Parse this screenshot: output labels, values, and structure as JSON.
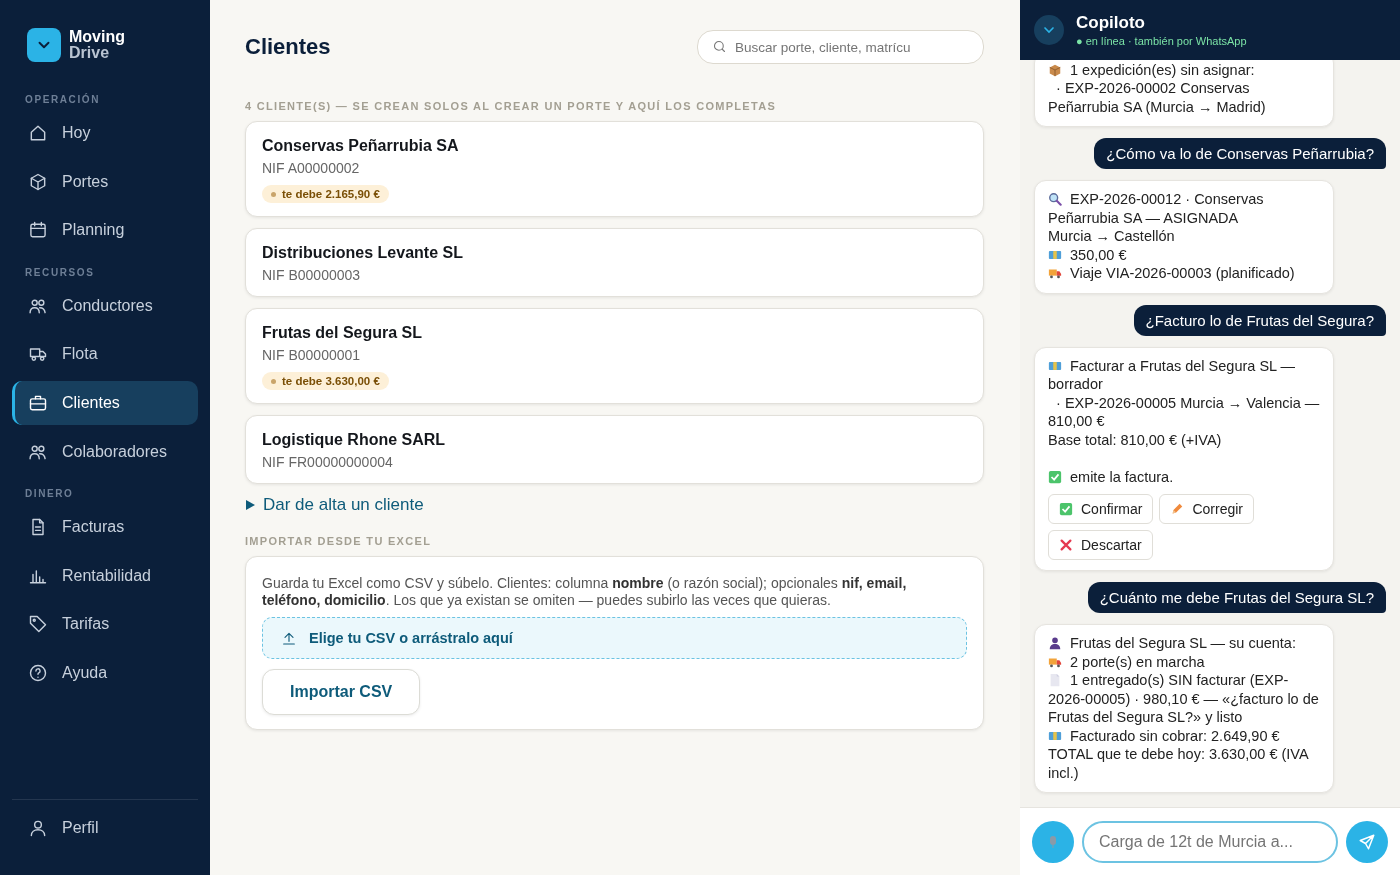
{
  "brand": {
    "line1": "Moving",
    "line2": "Drive"
  },
  "sidebar": {
    "sections": [
      {
        "title": "OPERACIÓN",
        "items": [
          {
            "label": "Hoy",
            "kind": "home",
            "selected": false
          },
          {
            "label": "Portes",
            "kind": "cube",
            "selected": false
          },
          {
            "label": "Planning",
            "kind": "calendar",
            "selected": false
          }
        ]
      },
      {
        "title": "RECURSOS",
        "items": [
          {
            "label": "Conductores",
            "kind": "people",
            "selected": false
          },
          {
            "label": "Flota",
            "kind": "truck",
            "selected": false
          },
          {
            "label": "Clientes",
            "kind": "briefcase",
            "selected": true
          },
          {
            "label": "Colaboradores",
            "kind": "people",
            "selected": false
          }
        ]
      },
      {
        "title": "DINERO",
        "items": [
          {
            "label": "Facturas",
            "kind": "document",
            "selected": false
          },
          {
            "label": "Rentabilidad",
            "kind": "chart",
            "selected": false
          },
          {
            "label": "Tarifas",
            "kind": "tag",
            "selected": false
          },
          {
            "label": "Ayuda",
            "kind": "help",
            "selected": false
          }
        ]
      }
    ],
    "footer_item": {
      "label": "Perfil",
      "kind": "user"
    }
  },
  "page": {
    "title": "Clientes",
    "search": {
      "placeholder": "Buscar porte, cliente, matrícu"
    },
    "list_caption": "4 CLIENTE(S) — SE CREAN SOLOS AL CREAR UN PORTE Y AQUÍ LOS COMPLETAS",
    "clients": [
      {
        "name": "Conservas Peñarrubia SA",
        "nif": "NIF A00000002",
        "debt": "te debe 2.165,90 €"
      },
      {
        "name": "Distribuciones Levante SL",
        "nif": "NIF B00000003"
      },
      {
        "name": "Frutas del Segura SL",
        "nif": "NIF B00000001",
        "debt": "te debe 3.630,00 €"
      },
      {
        "name": "Logistique Rhone SARL",
        "nif": "NIF FR00000000004"
      }
    ],
    "add_client": {
      "label": "Dar de alta un cliente",
      "expanded": false
    },
    "import_caption": "IMPORTAR DESDE TU EXCEL",
    "import": {
      "text": "Guarda tu Excel como CSV y súbelo. Clientes: columna **nombre** (o razón social); opcionales **nif, email, teléfono, domicilio**. Los que ya existan se omiten — puedes subirlo las veces que quieras.",
      "dropzone": "Elige tu CSV o arrástralo aquí",
      "button": "Importar CSV"
    }
  },
  "copilot": {
    "title": "Copiloto",
    "status": "● en línea · también por WhatsApp",
    "messages": [
      {
        "kind": "bot",
        "lines": [
          {
            "kind": "box",
            "text": "1 expedición(es) sin asignar:"
          },
          {
            "kind": "plain",
            "text": "  · EXP-2026-00002 Conservas Peñarrubia SA (Murcia → Madrid)"
          }
        ]
      },
      {
        "kind": "user",
        "text": "¿Cómo va lo de Conservas Peñarrubia?"
      },
      {
        "kind": "bot",
        "lines": [
          {
            "kind": "search",
            "text": "EXP-2026-00012 · Conservas Peñarrubia SA — ASIGNADA"
          },
          {
            "kind": "plain",
            "text": "Murcia → Castellón"
          },
          {
            "kind": "money",
            "text": "350,00 €"
          },
          {
            "kind": "truck",
            "text": "Viaje VIA-2026-00003 (planificado)"
          }
        ]
      },
      {
        "kind": "user",
        "text": "¿Facturo lo de Frutas del Segura?"
      },
      {
        "kind": "bot",
        "lines": [
          {
            "kind": "money",
            "text": "Facturar a Frutas del Segura SL — borrador"
          },
          {
            "kind": "plain",
            "text": "  · EXP-2026-00005 Murcia → Valencia — 810,00 €"
          },
          {
            "kind": "plain",
            "text": "Base total: 810,00 € (+IVA)"
          },
          {
            "kind": "check",
            "text": "emite la factura.",
            "spaced": true
          }
        ],
        "actions": [
          {
            "kind": "check",
            "label": "Confirmar"
          },
          {
            "kind": "pencil",
            "label": "Corregir"
          },
          {
            "kind": "cross",
            "label": "Descartar"
          }
        ]
      },
      {
        "kind": "user",
        "text": "¿Cuánto me debe Frutas del Segura SL?"
      },
      {
        "kind": "bot",
        "lines": [
          {
            "kind": "person",
            "text": "Frutas del Segura SL — su cuenta:"
          },
          {
            "kind": "truck",
            "text": "2 porte(s) en marcha"
          },
          {
            "kind": "doc",
            "text": "1 entregado(s) SIN facturar (EXP-2026-00005) · 980,10 € — «¿facturo lo de Frutas del Segura SL?» y listo"
          },
          {
            "kind": "money",
            "text": "Facturado sin cobrar: 2.649,90 €"
          },
          {
            "kind": "plain",
            "text": "TOTAL que te debe hoy: 3.630,00 € (IVA incl.)"
          }
        ]
      }
    ],
    "input": {
      "placeholder": "Carga de 12t de Murcia a..."
    }
  }
}
